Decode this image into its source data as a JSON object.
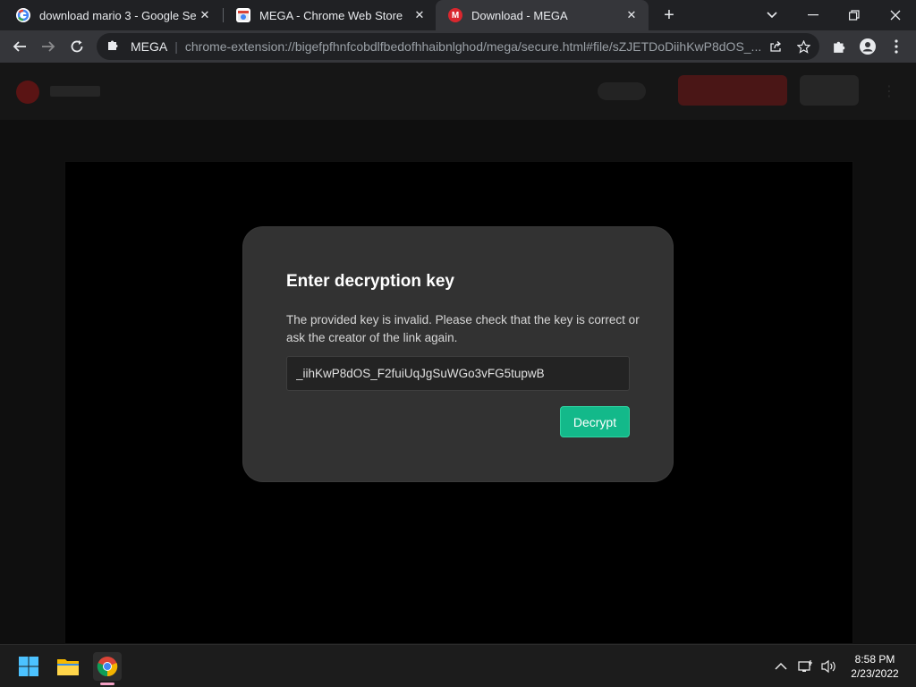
{
  "browser": {
    "tabs": [
      {
        "title": "download mario 3 - Google Sear",
        "favicon": "google-icon"
      },
      {
        "title": "MEGA - Chrome Web Store",
        "favicon": "chrome-web-store-icon"
      },
      {
        "title": "Download - MEGA",
        "favicon": "mega-icon",
        "favicon_letter": "M",
        "active": true
      }
    ],
    "omnibox": {
      "site": "MEGA",
      "url": "chrome-extension://bigefpfhnfcobdlfbedofhhaibnlghod/mega/secure.html#file/sZJETDoDiihKwP8dOS_..."
    }
  },
  "dialog": {
    "title": "Enter decryption key",
    "message": "The provided key is invalid. Please check that the key is correct or ask the creator of the link again.",
    "key_value": "_iihKwP8dOS_F2fuiUqJgSuWGo3vFG5tupwB",
    "decrypt_label": "Decrypt"
  },
  "taskbar": {
    "time": "8:58 PM",
    "date": "2/23/2022"
  },
  "colors": {
    "accent_green": "#13b98a",
    "dialog_bg": "#323232",
    "mega_red": "#d9272e"
  }
}
